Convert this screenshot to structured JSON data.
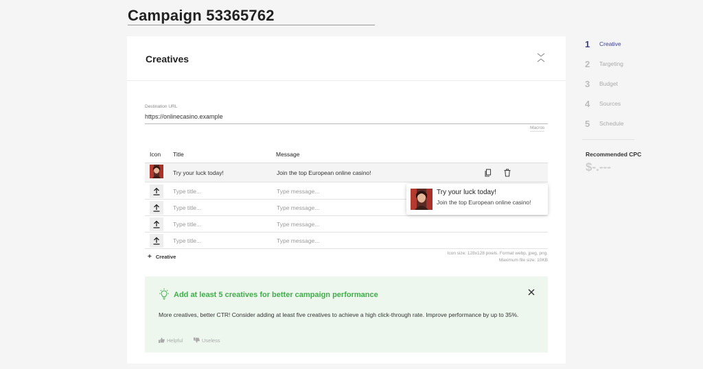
{
  "page": {
    "title": "Campaign 53365762"
  },
  "creatives_card": {
    "title": "Creatives",
    "destination_label": "Destination URL",
    "destination_value": "https://onlinecasino.example",
    "macros_label": "Macros",
    "columns": {
      "icon": "Icon",
      "title": "Title",
      "message": "Message"
    },
    "rows": [
      {
        "title": "Try your luck today!",
        "message": "Join the top European online casino!"
      },
      {
        "title_placeholder": "Type title...",
        "message_placeholder": "Type message..."
      },
      {
        "title_placeholder": "Type title...",
        "message_placeholder": "Type message..."
      },
      {
        "title_placeholder": "Type title...",
        "message_placeholder": "Type message..."
      },
      {
        "title_placeholder": "Type title...",
        "message_placeholder": "Type message..."
      }
    ],
    "add_creative_label": "Creative",
    "icon_hint_line1": "Icon size: 128x128 pixels. Format webp, jpeg, png.",
    "icon_hint_line2": "Maximum file size: 10KB"
  },
  "preview": {
    "title": "Try your luck today!",
    "message": "Join the top European online casino!"
  },
  "tip": {
    "title": "Add at least 5 creatives for better campaign performance",
    "body": "More creatives, better CTR! Consider adding at least five creatives to achieve a high click-through rate. Improve performance by up to 35%.",
    "helpful_label": "Helpful",
    "useless_label": "Useless"
  },
  "steps": [
    {
      "number": "1",
      "label": "Creative",
      "active": true
    },
    {
      "number": "2",
      "label": "Targeting",
      "active": false
    },
    {
      "number": "3",
      "label": "Budget",
      "active": false
    },
    {
      "number": "4",
      "label": "Sources",
      "active": false
    },
    {
      "number": "5",
      "label": "Schedule",
      "active": false
    }
  ],
  "cpc": {
    "label": "Recommended CPC",
    "value": "$-.---"
  },
  "colors": {
    "accent": "#3b3f8c",
    "tip_green": "#3fae49",
    "tip_background": "#eef7ee"
  },
  "icons": {
    "collapse": "collapse-chevrons-icon",
    "upload": "upload-icon",
    "copy": "copy-icon",
    "delete": "trash-icon",
    "bulb": "lightbulb-icon",
    "close": "close-icon",
    "thumb_up": "thumbs-up-icon",
    "thumb_down": "thumbs-down-icon"
  }
}
